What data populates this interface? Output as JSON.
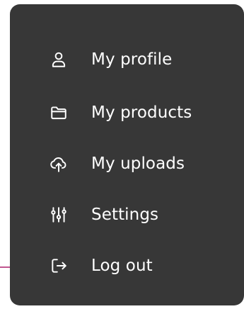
{
  "menu": {
    "items": [
      {
        "label": "My profile",
        "icon": "user-icon"
      },
      {
        "label": "My products",
        "icon": "folder-icon"
      },
      {
        "label": "My uploads",
        "icon": "cloud-upload-icon"
      },
      {
        "label": "Settings",
        "icon": "sliders-icon"
      },
      {
        "label": "Log out",
        "icon": "logout-icon"
      }
    ]
  },
  "colors": {
    "panel_background": "#373737",
    "text": "#ffffff",
    "connector_line": "#c0578f"
  }
}
